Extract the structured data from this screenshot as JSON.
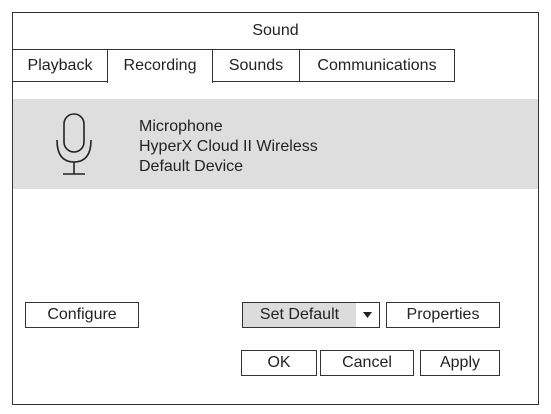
{
  "window": {
    "title": "Sound"
  },
  "tabs": [
    {
      "label": "Playback",
      "active": false
    },
    {
      "label": "Recording",
      "active": true
    },
    {
      "label": "Sounds",
      "active": false
    },
    {
      "label": "Communications",
      "active": false
    }
  ],
  "device": {
    "icon": "microphone-icon",
    "name": "Microphone",
    "model": "HyperX Cloud II Wireless",
    "status": "Default Device",
    "selected": true
  },
  "actions": {
    "configure_label": "Configure",
    "set_default_label": "Set Default",
    "set_default_dropdown_icon": "caret-down-icon",
    "properties_label": "Properties"
  },
  "dialog_buttons": {
    "ok_label": "OK",
    "cancel_label": "Cancel",
    "apply_label": "Apply"
  },
  "colors": {
    "selected_row": "#dedede",
    "border": "#333333",
    "set_default_bg": "#dcdcdc"
  }
}
